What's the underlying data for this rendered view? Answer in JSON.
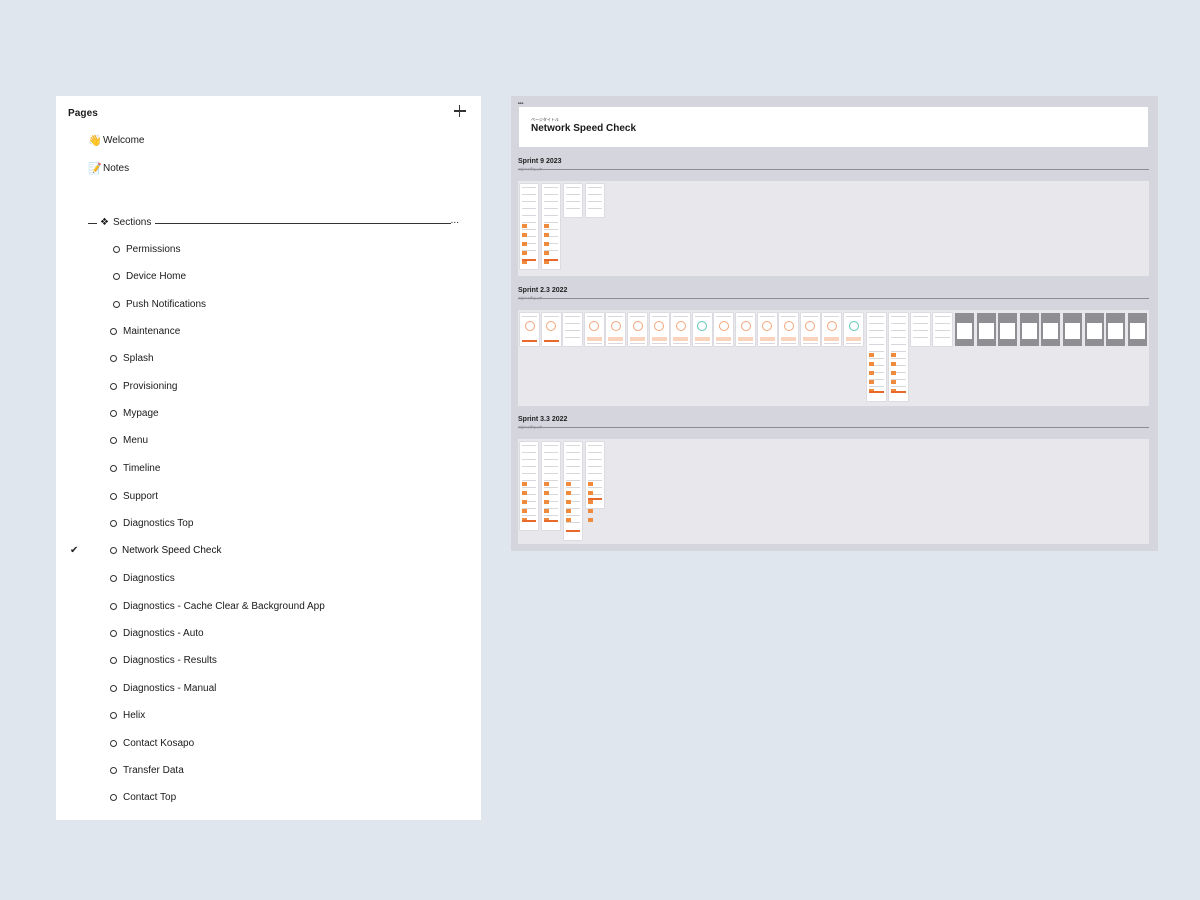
{
  "pages": {
    "header": "Pages",
    "top_items": [
      {
        "emoji": "👋",
        "label": "Welcome"
      },
      {
        "emoji": "📝",
        "label": "Notes"
      }
    ],
    "section_divider": {
      "label": "Sections",
      "dots": "..."
    },
    "sub_items": [
      "Permissions",
      "Device Home",
      "Push Notifications"
    ],
    "items": [
      "Maintenance",
      "Splash",
      "Provisioning",
      "Mypage",
      "Menu",
      "Timeline",
      "Support",
      "Diagnostics Top",
      "Network Speed Check",
      "Diagnostics",
      "Diagnostics - Cache Clear & Background App",
      "Diagnostics - Auto",
      "Diagnostics - Results",
      "Diagnostics - Manual",
      "Helix",
      "Contact Kosapo",
      "Transfer Data",
      "Contact Top"
    ],
    "active_item": "Network Speed Check",
    "check_mark": "✔"
  },
  "canvas": {
    "tiny_label": "■■■",
    "title_card": {
      "subtitle": "ページタイトル",
      "title": "Network Speed Check"
    },
    "sprints": [
      {
        "title": "Sprint 9 2023",
        "subtitle": "スピードチェック"
      },
      {
        "title": "Sprint 2.3 2022",
        "subtitle": "スピードチェック"
      },
      {
        "title": "Sprint 3.3 2022",
        "subtitle": "スピードチェック"
      }
    ]
  }
}
